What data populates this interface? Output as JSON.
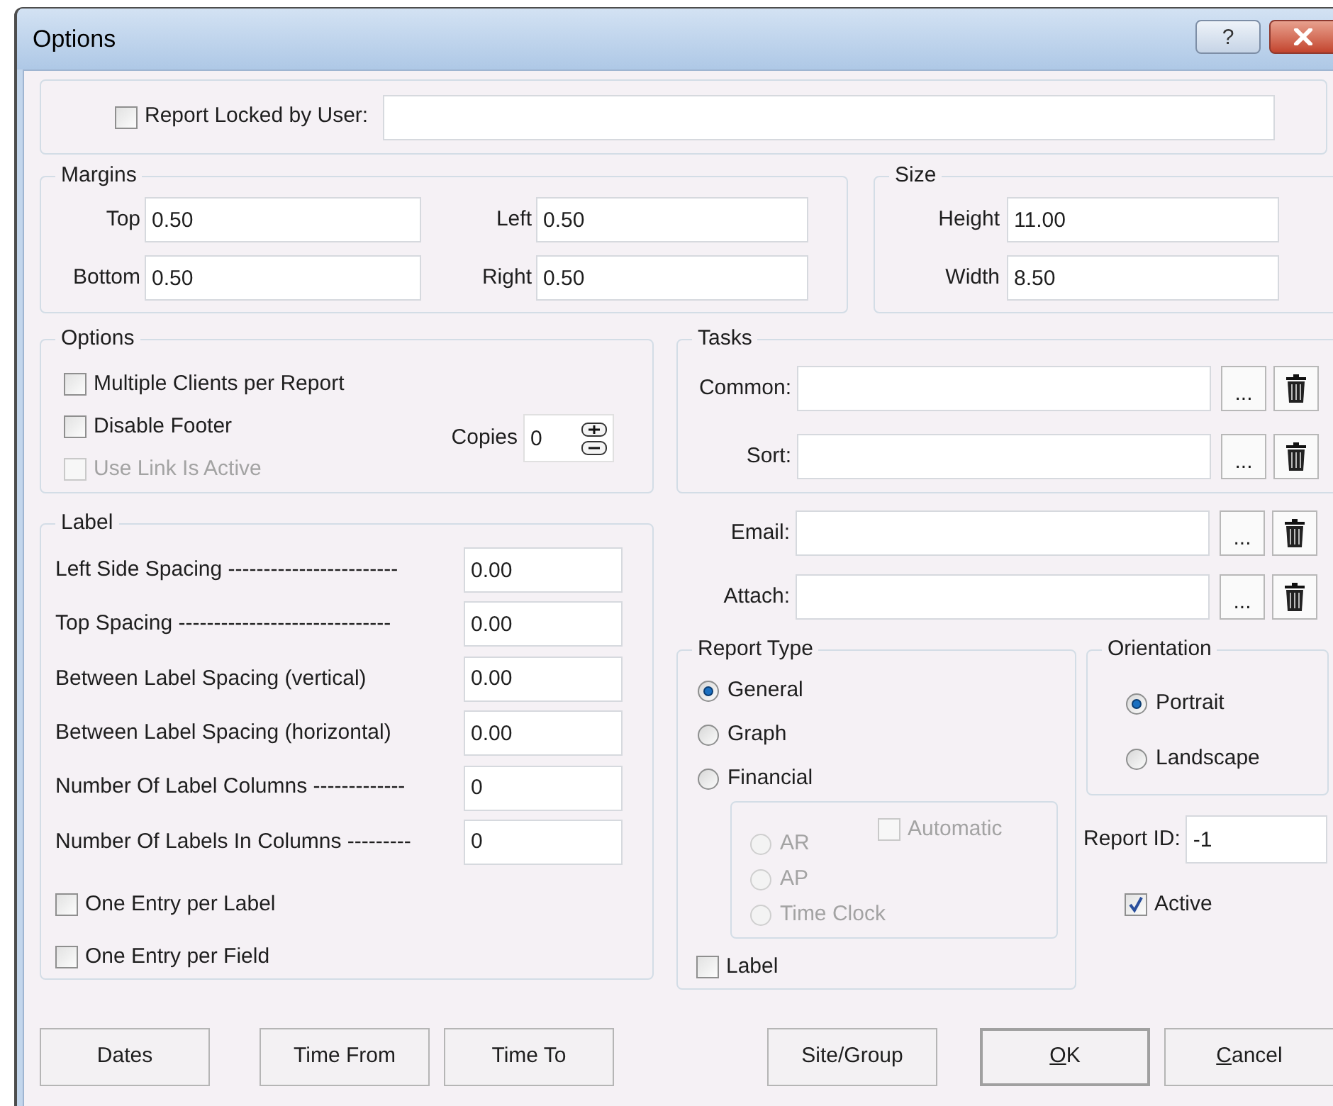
{
  "window": {
    "title": "Options",
    "help_label": "?"
  },
  "report_lock": {
    "label": "Report Locked by User:",
    "checked": false
  },
  "margins": {
    "title": "Margins",
    "fields": [
      {
        "label": "Top",
        "value": "0.50"
      },
      {
        "label": "Left",
        "value": "0.50"
      },
      {
        "label": "Bottom",
        "value": "0.50"
      },
      {
        "label": "Right",
        "value": "0.50"
      }
    ]
  },
  "size": {
    "title": "Size",
    "fields": [
      {
        "label": "Height",
        "value": "11.00"
      },
      {
        "label": "Width",
        "value": "8.50"
      }
    ]
  },
  "options": {
    "title": "Options",
    "checkboxes": [
      {
        "label": "Multiple Clients per Report",
        "checked": false,
        "disabled": false
      },
      {
        "label": "Disable Footer",
        "checked": false,
        "disabled": false
      },
      {
        "label": "Use Link Is Active",
        "checked": false,
        "disabled": true
      }
    ],
    "copies": {
      "label": "Copies",
      "value": "0"
    }
  },
  "label_settings": {
    "title": "Label",
    "fields": [
      {
        "label": "Left Side Spacing ------------------------",
        "value": "0.00"
      },
      {
        "label": "Top Spacing ------------------------------",
        "value": "0.00"
      },
      {
        "label": "Between Label Spacing (vertical)",
        "value": "0.00"
      },
      {
        "label": "Between Label Spacing (horizontal)",
        "value": "0.00"
      },
      {
        "label": "Number Of Label Columns -------------",
        "value": "0"
      },
      {
        "label": "Number Of Labels In Columns ---------",
        "value": "0"
      }
    ],
    "checkboxes": [
      {
        "label": "One Entry per Label",
        "checked": false
      },
      {
        "label": "One Entry per Field",
        "checked": false
      }
    ]
  },
  "tasks": {
    "title": "Tasks",
    "rows": [
      {
        "label": "Common:",
        "browse": "..."
      },
      {
        "label": "Sort:",
        "browse": "..."
      }
    ]
  },
  "attachments": [
    {
      "label": "Email:",
      "browse": "..."
    },
    {
      "label": "Attach:",
      "browse": "..."
    }
  ],
  "report_type": {
    "title": "Report Type",
    "options": [
      {
        "label": "General",
        "selected": true
      },
      {
        "label": "Graph",
        "selected": false
      },
      {
        "label": "Financial",
        "selected": false
      }
    ],
    "financial_options": [
      {
        "label": "AR",
        "selected": false,
        "disabled": true
      },
      {
        "label": "AP",
        "selected": false,
        "disabled": true
      },
      {
        "label": "Time Clock",
        "selected": false,
        "disabled": true
      }
    ],
    "automatic": {
      "label": "Automatic",
      "checked": false,
      "disabled": true
    },
    "label_checkbox": {
      "label": "Label",
      "checked": false
    }
  },
  "orientation": {
    "title": "Orientation",
    "options": [
      {
        "label": "Portrait",
        "selected": true
      },
      {
        "label": "Landscape",
        "selected": false
      }
    ]
  },
  "report_id": {
    "label": "Report ID:",
    "value": "-1"
  },
  "active": {
    "label": "Active",
    "checked": true
  },
  "buttons": [
    {
      "label": "Dates",
      "default": false
    },
    {
      "label": "Time From",
      "default": false
    },
    {
      "label": "Time To",
      "default": false
    },
    {
      "label": "Site/Group",
      "default": false
    },
    {
      "mnemonic": "O",
      "label": "K",
      "default": true
    },
    {
      "mnemonic": "C",
      "label": "ancel",
      "default": false
    }
  ]
}
